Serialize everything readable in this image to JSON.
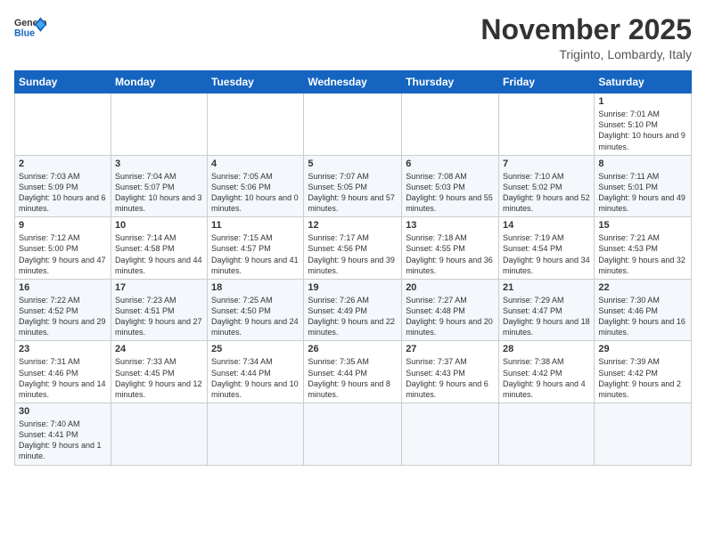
{
  "header": {
    "logo_general": "General",
    "logo_blue": "Blue",
    "month_title": "November 2025",
    "location": "Triginto, Lombardy, Italy"
  },
  "weekdays": [
    "Sunday",
    "Monday",
    "Tuesday",
    "Wednesday",
    "Thursday",
    "Friday",
    "Saturday"
  ],
  "weeks": [
    [
      {
        "num": "",
        "info": ""
      },
      {
        "num": "",
        "info": ""
      },
      {
        "num": "",
        "info": ""
      },
      {
        "num": "",
        "info": ""
      },
      {
        "num": "",
        "info": ""
      },
      {
        "num": "",
        "info": ""
      },
      {
        "num": "1",
        "info": "Sunrise: 7:01 AM\nSunset: 5:10 PM\nDaylight: 10 hours and 9 minutes."
      }
    ],
    [
      {
        "num": "2",
        "info": "Sunrise: 7:03 AM\nSunset: 5:09 PM\nDaylight: 10 hours and 6 minutes."
      },
      {
        "num": "3",
        "info": "Sunrise: 7:04 AM\nSunset: 5:07 PM\nDaylight: 10 hours and 3 minutes."
      },
      {
        "num": "4",
        "info": "Sunrise: 7:05 AM\nSunset: 5:06 PM\nDaylight: 10 hours and 0 minutes."
      },
      {
        "num": "5",
        "info": "Sunrise: 7:07 AM\nSunset: 5:05 PM\nDaylight: 9 hours and 57 minutes."
      },
      {
        "num": "6",
        "info": "Sunrise: 7:08 AM\nSunset: 5:03 PM\nDaylight: 9 hours and 55 minutes."
      },
      {
        "num": "7",
        "info": "Sunrise: 7:10 AM\nSunset: 5:02 PM\nDaylight: 9 hours and 52 minutes."
      },
      {
        "num": "8",
        "info": "Sunrise: 7:11 AM\nSunset: 5:01 PM\nDaylight: 9 hours and 49 minutes."
      }
    ],
    [
      {
        "num": "9",
        "info": "Sunrise: 7:12 AM\nSunset: 5:00 PM\nDaylight: 9 hours and 47 minutes."
      },
      {
        "num": "10",
        "info": "Sunrise: 7:14 AM\nSunset: 4:58 PM\nDaylight: 9 hours and 44 minutes."
      },
      {
        "num": "11",
        "info": "Sunrise: 7:15 AM\nSunset: 4:57 PM\nDaylight: 9 hours and 41 minutes."
      },
      {
        "num": "12",
        "info": "Sunrise: 7:17 AM\nSunset: 4:56 PM\nDaylight: 9 hours and 39 minutes."
      },
      {
        "num": "13",
        "info": "Sunrise: 7:18 AM\nSunset: 4:55 PM\nDaylight: 9 hours and 36 minutes."
      },
      {
        "num": "14",
        "info": "Sunrise: 7:19 AM\nSunset: 4:54 PM\nDaylight: 9 hours and 34 minutes."
      },
      {
        "num": "15",
        "info": "Sunrise: 7:21 AM\nSunset: 4:53 PM\nDaylight: 9 hours and 32 minutes."
      }
    ],
    [
      {
        "num": "16",
        "info": "Sunrise: 7:22 AM\nSunset: 4:52 PM\nDaylight: 9 hours and 29 minutes."
      },
      {
        "num": "17",
        "info": "Sunrise: 7:23 AM\nSunset: 4:51 PM\nDaylight: 9 hours and 27 minutes."
      },
      {
        "num": "18",
        "info": "Sunrise: 7:25 AM\nSunset: 4:50 PM\nDaylight: 9 hours and 24 minutes."
      },
      {
        "num": "19",
        "info": "Sunrise: 7:26 AM\nSunset: 4:49 PM\nDaylight: 9 hours and 22 minutes."
      },
      {
        "num": "20",
        "info": "Sunrise: 7:27 AM\nSunset: 4:48 PM\nDaylight: 9 hours and 20 minutes."
      },
      {
        "num": "21",
        "info": "Sunrise: 7:29 AM\nSunset: 4:47 PM\nDaylight: 9 hours and 18 minutes."
      },
      {
        "num": "22",
        "info": "Sunrise: 7:30 AM\nSunset: 4:46 PM\nDaylight: 9 hours and 16 minutes."
      }
    ],
    [
      {
        "num": "23",
        "info": "Sunrise: 7:31 AM\nSunset: 4:46 PM\nDaylight: 9 hours and 14 minutes."
      },
      {
        "num": "24",
        "info": "Sunrise: 7:33 AM\nSunset: 4:45 PM\nDaylight: 9 hours and 12 minutes."
      },
      {
        "num": "25",
        "info": "Sunrise: 7:34 AM\nSunset: 4:44 PM\nDaylight: 9 hours and 10 minutes."
      },
      {
        "num": "26",
        "info": "Sunrise: 7:35 AM\nSunset: 4:44 PM\nDaylight: 9 hours and 8 minutes."
      },
      {
        "num": "27",
        "info": "Sunrise: 7:37 AM\nSunset: 4:43 PM\nDaylight: 9 hours and 6 minutes."
      },
      {
        "num": "28",
        "info": "Sunrise: 7:38 AM\nSunset: 4:42 PM\nDaylight: 9 hours and 4 minutes."
      },
      {
        "num": "29",
        "info": "Sunrise: 7:39 AM\nSunset: 4:42 PM\nDaylight: 9 hours and 2 minutes."
      }
    ],
    [
      {
        "num": "30",
        "info": "Sunrise: 7:40 AM\nSunset: 4:41 PM\nDaylight: 9 hours and 1 minute."
      },
      {
        "num": "",
        "info": ""
      },
      {
        "num": "",
        "info": ""
      },
      {
        "num": "",
        "info": ""
      },
      {
        "num": "",
        "info": ""
      },
      {
        "num": "",
        "info": ""
      },
      {
        "num": "",
        "info": ""
      }
    ]
  ]
}
